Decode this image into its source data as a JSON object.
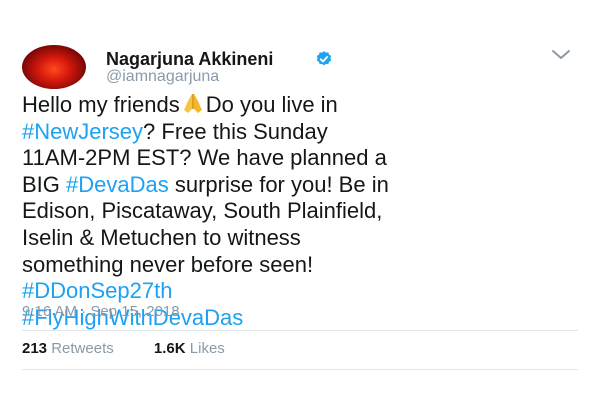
{
  "author": {
    "name": "Nagarjuna Akkineni",
    "handle": "@iamnagarjuna",
    "verified": true
  },
  "tweet": {
    "line1_a": "Hello my friends",
    "line1_b": "Do you live in",
    "line2_link": "#NewJersey",
    "line2_rest": "? Free this Sunday",
    "line3": "11AM-2PM EST? We have planned a",
    "line4_a": "BIG ",
    "line4_link": "#DevaDas",
    "line4_rest": " surprise for you! Be in",
    "line5": "Edison, Piscataway, South Plainfield,",
    "line6": "Iselin & Metuchen to witness",
    "line7": "something never before seen!",
    "hashtag1": "#DDonSep27th",
    "hashtag2": "#FlyHighWithDevaDas",
    "emoji": "folded-hands"
  },
  "timestamp": "9:16 AM · Sep 15, 2018",
  "stats": {
    "retweets_count": "213",
    "retweets_label": "Retweets",
    "likes_count": "1.6K",
    "likes_label": "Likes"
  },
  "colors": {
    "link": "#1da1f2",
    "text": "#14171a",
    "muted": "#8a9aa8",
    "verified_badge": "#1da1f2"
  },
  "icons": [
    "verified-badge-icon",
    "chevron-down-icon",
    "folded-hands-emoji"
  ]
}
